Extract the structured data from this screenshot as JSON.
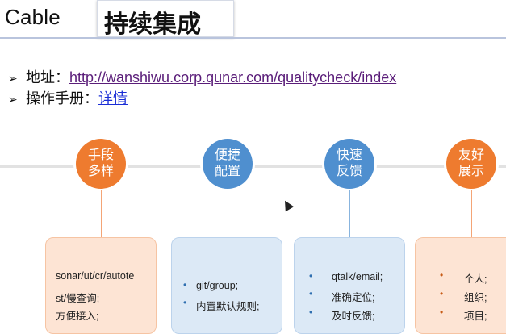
{
  "header": {
    "brand": "Cable",
    "title": "持续集成"
  },
  "bullets": [
    {
      "marker": "➢",
      "label": "地址：",
      "link": "http://wanshiwu.corp.qunar.com/qualitycheck/index"
    },
    {
      "marker": "➢",
      "label": "操作手册：",
      "link": "详情"
    }
  ],
  "features": [
    {
      "title_line1": "手段",
      "title_line2": "多样",
      "color": "#ee7b2f",
      "items": [
        "sonar/ut/cr/autote",
        "st/慢查询;",
        "方便接入;"
      ],
      "bulleted": false
    },
    {
      "title_line1": "便捷",
      "title_line2": "配置",
      "color": "#4f8fcf",
      "items": [
        "git/group;",
        "内置默认规则;"
      ],
      "bulleted": true
    },
    {
      "title_line1": "快速",
      "title_line2": "反馈",
      "color": "#4f8fcf",
      "items": [
        "qtalk/email;",
        "准确定位;",
        "及时反馈;"
      ],
      "bulleted": true
    },
    {
      "title_line1": "友好",
      "title_line2": "展示",
      "color": "#ee7b2f",
      "items": [
        "个人;",
        "组织;",
        "项目;"
      ],
      "bulleted": true
    }
  ]
}
